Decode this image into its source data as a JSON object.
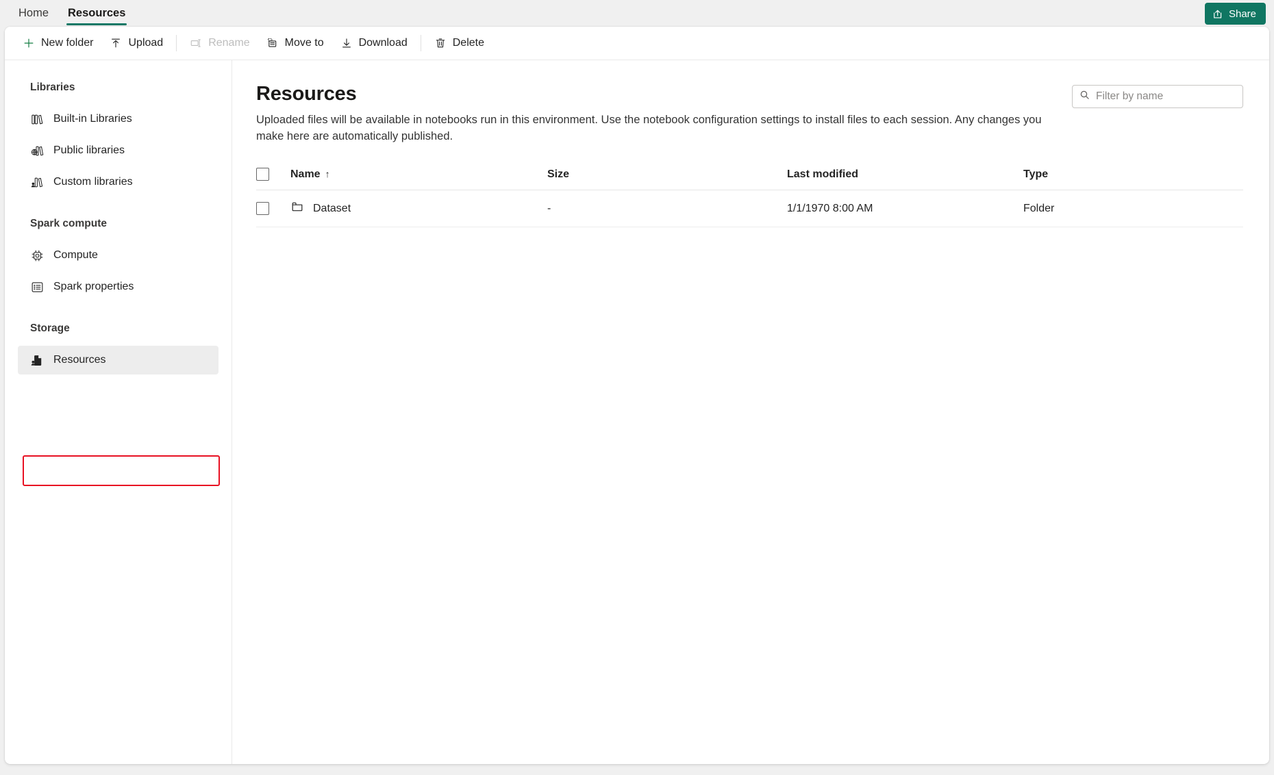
{
  "tabs": [
    {
      "label": "Home",
      "active": false
    },
    {
      "label": "Resources",
      "active": true
    }
  ],
  "share": {
    "label": "Share",
    "icon": "share-icon",
    "color": "#107662"
  },
  "toolbar": {
    "new_folder": "New folder",
    "upload": "Upload",
    "rename": "Rename",
    "move_to": "Move to",
    "download": "Download",
    "delete": "Delete"
  },
  "sidebar": {
    "groups": [
      {
        "title": "Libraries",
        "items": [
          {
            "label": "Built-in Libraries",
            "icon": "books-icon",
            "selected": false
          },
          {
            "label": "Public libraries",
            "icon": "globe-books-icon",
            "selected": false
          },
          {
            "label": "Custom libraries",
            "icon": "person-books-icon",
            "selected": false
          }
        ]
      },
      {
        "title": "Spark compute",
        "items": [
          {
            "label": "Compute",
            "icon": "cpu-chip-icon",
            "selected": false
          },
          {
            "label": "Spark properties",
            "icon": "list-settings-icon",
            "selected": false
          }
        ]
      },
      {
        "title": "Storage",
        "items": [
          {
            "label": "Resources",
            "icon": "resources-file-icon",
            "selected": true
          }
        ]
      }
    ],
    "highlight_color": "#e81123"
  },
  "main": {
    "title": "Resources",
    "description": "Uploaded files will be available in notebooks run in this environment. Use the notebook configuration settings to install files to each session. Any changes you make here are automatically published.",
    "filter": {
      "placeholder": "Filter by name",
      "value": ""
    },
    "table": {
      "columns": [
        "Name",
        "Size",
        "Last modified",
        "Type"
      ],
      "sort_column": "Name",
      "sort_direction": "ascending",
      "sort_glyph": "↑",
      "rows": [
        {
          "name": "Dataset",
          "icon": "folder-icon",
          "size": "-",
          "last_modified": "1/1/1970 8:00 AM",
          "type": "Folder",
          "checked": false
        }
      ]
    }
  }
}
